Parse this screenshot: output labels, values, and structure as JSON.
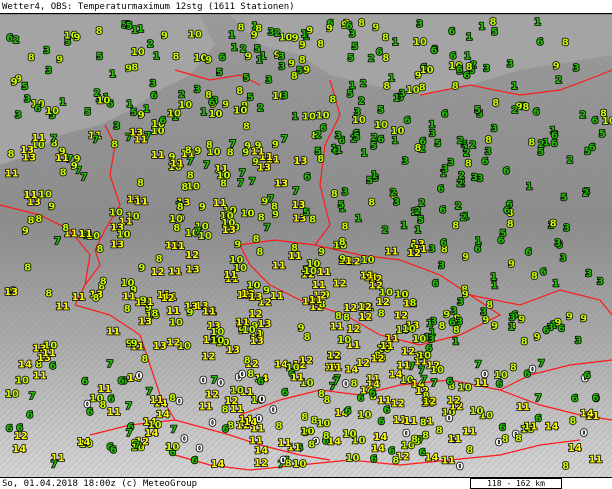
{
  "header": {
    "title": "Wetter4, OBS: Temperaturmaximum 12stg (1611 Stationen)"
  },
  "footer": {
    "timestamp": "So, 01.04.2018 18:00z (c) MeteoGroup",
    "scale": "118 - 162 km"
  },
  "colors": {
    "background": "#8a8a8a",
    "sea": "#9a9a9a",
    "border": "#ff1a1a",
    "cold": "#22c400",
    "mild": "#c8ff00",
    "warm": "#ffff00",
    "freezing": "#ffffff",
    "below_zero": "#ff66ff"
  },
  "icons": [
    "scale-bar-icon"
  ],
  "observations": [
    {
      "v": "4",
      "c": "cold"
    },
    {
      "v": "1",
      "c": "cold"
    },
    {
      "v": "5",
      "c": "cold"
    },
    {
      "v": "6",
      "c": "cold"
    },
    {
      "v": "8",
      "c": "mild"
    },
    {
      "v": "9",
      "c": "mild"
    },
    {
      "v": "10",
      "c": "mild"
    },
    {
      "v": "11",
      "c": "warm"
    },
    {
      "v": "12",
      "c": "warm"
    },
    {
      "v": "13",
      "c": "warm"
    },
    {
      "v": "3",
      "c": "cold"
    },
    {
      "v": "2",
      "c": "cold"
    },
    {
      "v": "7",
      "c": "cold"
    },
    {
      "v": "0",
      "c": "freezing"
    },
    {
      "v": "14",
      "c": "warm"
    }
  ]
}
